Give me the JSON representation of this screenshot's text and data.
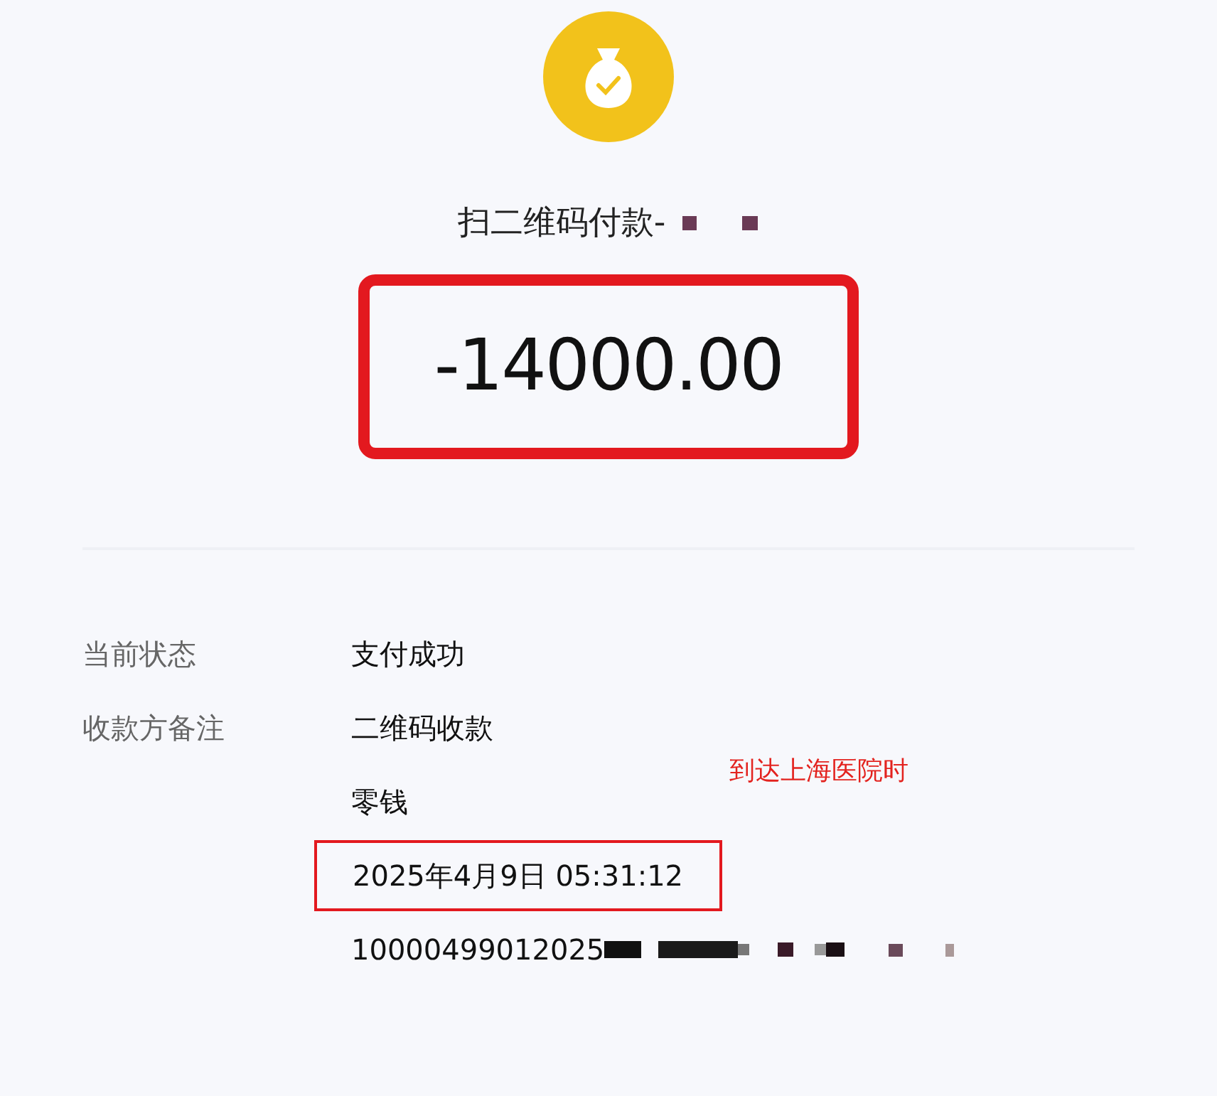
{
  "header": {
    "title": "扫二维码付款-",
    "redacted": true,
    "amount": "-14000.00"
  },
  "details": [
    {
      "label": "当前状态",
      "value": "支付成功",
      "redacted": false,
      "highlighted": false
    },
    {
      "label": "收款方备注",
      "value": "二维码收款",
      "redacted": false,
      "highlighted": false
    },
    {
      "value": "零钱",
      "redacted": false,
      "highlighted": false
    },
    {
      "value": "2025年4月9日 05:31:12",
      "redacted": false,
      "highlighted": true
    },
    {
      "value": "10000499012025",
      "redacted": true,
      "highlighted": false
    }
  ],
  "annotation": "到达上海医院时"
}
